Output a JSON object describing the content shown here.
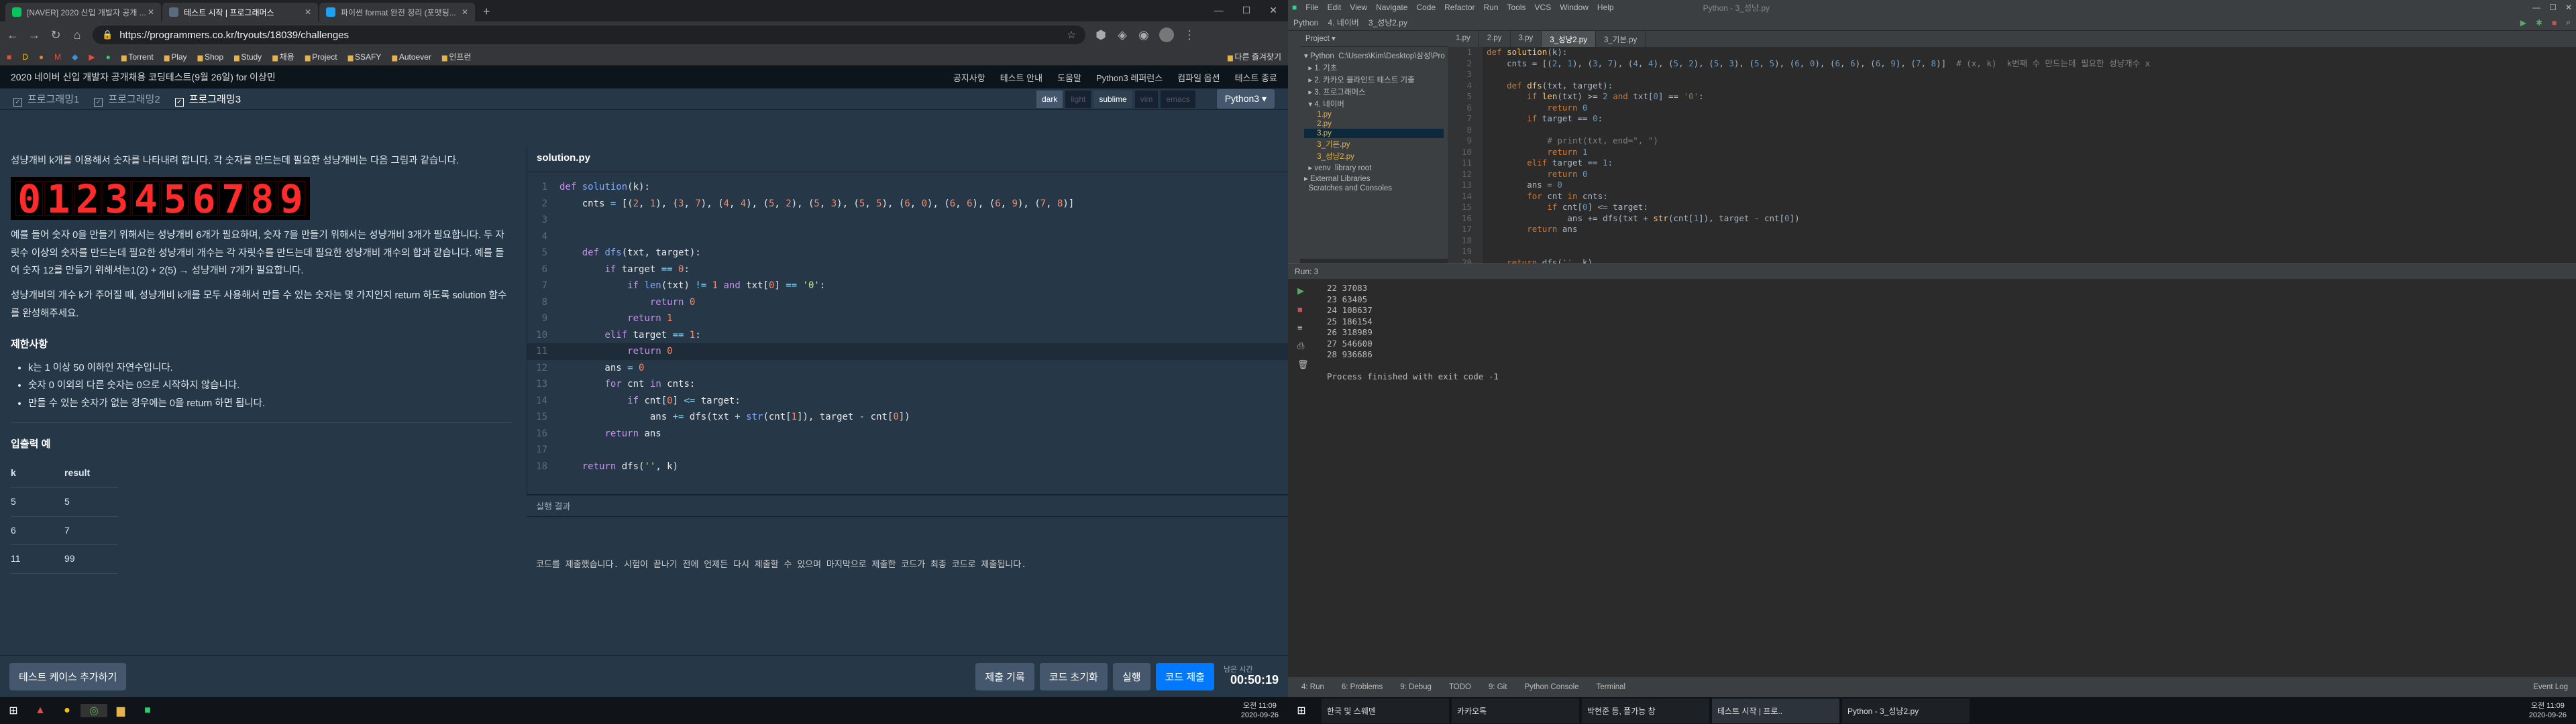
{
  "browser": {
    "tabs": [
      {
        "title": "[NAVER] 2020 신입 개발자 공개 ...",
        "color": "#03c75a"
      },
      {
        "title": "테스트 시작 | 프로그래머스",
        "color": "#2d3a4a"
      },
      {
        "title": "파이썬 format 완전 정리 (포맷팅...",
        "color": "#1da1f2"
      }
    ],
    "url": "https://programmers.co.kr/tryouts/18039/challenges",
    "bookmarks": [
      "Torrent",
      "Play",
      "Shop",
      "Study",
      "채용",
      "Project",
      "SSAFY",
      "Autoever",
      "인프런"
    ],
    "other_bookmarks": "다른 즐겨찾기"
  },
  "prog": {
    "title": "2020 네이버 신입 개발자 공개채용 코딩테스트(9월 26일) for 이상민",
    "menu": [
      "공지사항",
      "테스트 안내",
      "도움말",
      "Python3 레퍼런스",
      "컴파일 옵션",
      "테스트 종료"
    ],
    "tabs": [
      "프로그래밍1",
      "프로그래밍2",
      "프로그래밍3"
    ],
    "themes": [
      "dark",
      "light",
      "sublime",
      "vim",
      "emacs"
    ],
    "language": "Python3 ▾",
    "p1": "성냥개비 k개를 이용해서 숫자를 나타내려 합니다. 각 숫자를 만드는데 필요한 성냥개비는 다음 그림과 같습니다.",
    "digits": [
      "0",
      "1",
      "2",
      "3",
      "4",
      "5",
      "6",
      "7",
      "8",
      "9"
    ],
    "p2": "예를 들어 숫자 0을 만들기 위해서는 성냥개비 6개가 필요하며, 숫자 7을 만들기 위해서는 성냥개비 3개가 필요합니다. 두 자릿수 이상의 숫자를 만드는데 필요한 성냥개비 개수는 각 자릿수를 만드는데 필요한 성냥개비 개수의 합과 같습니다. 예를 들어 숫자 12를 만들기 위해서는1(2) + 2(5) → 성냥개비 7개가 필요합니다.",
    "p3": "성냥개비의 개수 k가 주어질 때, 성냥개비 k개를  모두  사용해서 만들 수 있는 숫자는 몇 가지인지 return 하도록 solution 함수를 완성해주세요.",
    "limits_title": "제한사항",
    "limits": [
      "k는 1 이상 50 이하인 자연수입니다.",
      "숫자 0 이외의 다른 숫자는 0으로 시작하지 않습니다.",
      "만들 수 있는 숫자가 없는 경우에는 0을 return 하면 됩니다."
    ],
    "io_title": "입출력 예",
    "io_head": [
      "k",
      "result"
    ],
    "io_rows": [
      [
        "5",
        "5"
      ],
      [
        "6",
        "7"
      ],
      [
        "11",
        "99"
      ]
    ],
    "editor_title": "solution.py",
    "result_title": "실행 결과",
    "result_msg": "코드를 제출했습니다. 시험이 끝나기 전에 언제든 다시 제출할 수 있으며 마지막으로 제출한 코드가 최종 코드로 제출됩니다.",
    "add_case": "테스트 케이스 추가하기",
    "buttons": [
      "제출 기록",
      "코드 초기화",
      "실행",
      "코드 제출"
    ],
    "timer_label": "남은 시간",
    "timer": "00:50:19"
  },
  "pycharm": {
    "menu": [
      "File",
      "Edit",
      "View",
      "Navigate",
      "Code",
      "Refactor",
      "Run",
      "Tools",
      "VCS",
      "Window",
      "Help",
      "Python - 3_성냥.py"
    ],
    "nav": [
      "Python",
      "4. 네이버",
      "3_성냥2.py"
    ],
    "project_title": "Project ▾",
    "tree": [
      "▾ Python  C:\\Users\\Kim\\Desktop\\삼성\\Pro",
      "  ▸ 1. 기초",
      "  ▸ 2. 카카오 블라인드 테스트 기출",
      "  ▸ 3. 프로그래머스",
      "  ▾ 4. 네이버",
      "      1.py",
      "      2.py",
      "      3.py",
      "      3_기본.py",
      "      3_성냥2.py",
      "  ▸ venv  library root",
      "▸ External Libraries",
      "  Scratches and Consoles"
    ],
    "editor_tabs": [
      "1.py",
      "2.py",
      "3.py",
      "3_성냥2.py",
      "3_기본.py"
    ],
    "run_title": "Run:  3",
    "output": [
      "22  37083",
      "23  63405",
      "24  108637",
      "25  186154",
      "26  318989",
      "27  546600",
      "28  936686",
      "",
      "Process finished with exit code -1"
    ],
    "bottom": [
      "4: Run",
      "6: Problems",
      "9: Debug",
      "TODO",
      "9: Git",
      "Python Console",
      "Terminal",
      "Event Log"
    ]
  },
  "taskbar_left": {
    "time": "오전 11:09",
    "date": "2020-09-26"
  },
  "taskbar_right": {
    "apps": [
      "한국 및 스웨덴",
      "카카오톡",
      "박현준 등, 플가능 창",
      "테스트 시작 | 프로..",
      "Python - 3_성냥2.py"
    ],
    "time": "오전 11:09",
    "date": "2020-09-26"
  }
}
